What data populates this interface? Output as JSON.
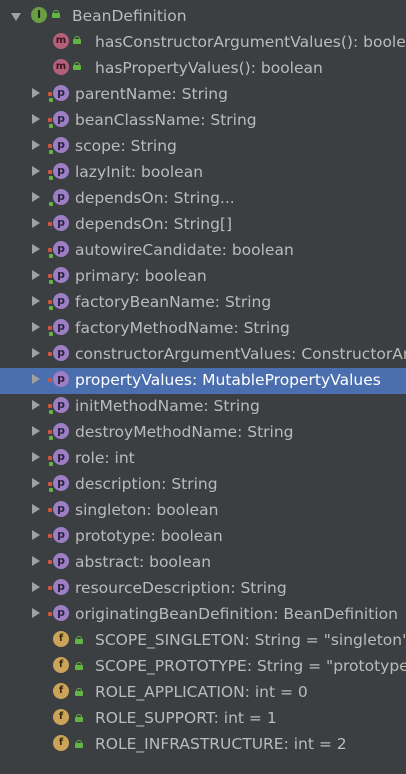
{
  "tree": {
    "root": {
      "label": "BeanDefinition",
      "icon": "interface-icon"
    },
    "methods": [
      {
        "label": "hasConstructorArgumentValues(): boolean",
        "icon": "method-icon"
      },
      {
        "label": "hasPropertyValues(): boolean",
        "icon": "method-icon"
      }
    ],
    "properties": [
      {
        "label": "parentName: String",
        "mods": "rw"
      },
      {
        "label": "beanClassName: String",
        "mods": "rw"
      },
      {
        "label": "scope: String",
        "mods": "rw"
      },
      {
        "label": "lazyInit: boolean",
        "mods": "rw"
      },
      {
        "label": "dependsOn: String...",
        "mods": "w"
      },
      {
        "label": "dependsOn: String[]",
        "mods": "r"
      },
      {
        "label": "autowireCandidate: boolean",
        "mods": "rw"
      },
      {
        "label": "primary: boolean",
        "mods": "rw"
      },
      {
        "label": "factoryBeanName: String",
        "mods": "rw"
      },
      {
        "label": "factoryMethodName: String",
        "mods": "rw"
      },
      {
        "label": "constructorArgumentValues: ConstructorArgumentValues",
        "mods": "r"
      },
      {
        "label": "propertyValues: MutablePropertyValues",
        "mods": "r",
        "selected": true
      },
      {
        "label": "initMethodName: String",
        "mods": "rw"
      },
      {
        "label": "destroyMethodName: String",
        "mods": "rw"
      },
      {
        "label": "role: int",
        "mods": "rw"
      },
      {
        "label": "description: String",
        "mods": "rw"
      },
      {
        "label": "singleton: boolean",
        "mods": "r"
      },
      {
        "label": "prototype: boolean",
        "mods": "r"
      },
      {
        "label": "abstract: boolean",
        "mods": "r"
      },
      {
        "label": "resourceDescription: String",
        "mods": "r"
      },
      {
        "label": "originatingBeanDefinition: BeanDefinition",
        "mods": "r"
      }
    ],
    "fields": [
      {
        "label": "SCOPE_SINGLETON: String = \"singleton\""
      },
      {
        "label": "SCOPE_PROTOTYPE: String = \"prototype\""
      },
      {
        "label": "ROLE_APPLICATION: int = 0"
      },
      {
        "label": "ROLE_SUPPORT: int = 1"
      },
      {
        "label": "ROLE_INFRASTRUCTURE: int = 2"
      }
    ]
  },
  "colors": {
    "background": "#3c3f41",
    "selection": "#4b6eaf",
    "text": "#bbbbbb",
    "interface_badge": "#6a9e44",
    "method_badge": "#b5607a",
    "property_badge": "#9b7ec3",
    "field_badge": "#cba45a",
    "public_lock": "#62b543",
    "getter_mark": "#d2553f"
  }
}
